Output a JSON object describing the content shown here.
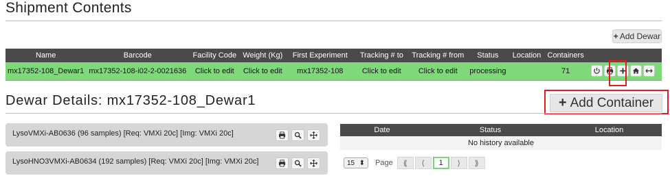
{
  "page_title": "Shipment Contents",
  "add_dewar": {
    "label": "Add Dewar",
    "plus": "+"
  },
  "shipment_table": {
    "headers": [
      "Name",
      "Barcode",
      "Facility Code",
      "Weight (Kg)",
      "First Experiment",
      "Tracking # to",
      "Tracking # from",
      "Status",
      "Location",
      "Containers",
      ""
    ],
    "row": {
      "name": "mx17352-108_Dewar1",
      "barcode": "mx17352-108-i02-2-0021636",
      "facility_code": "Click to edit",
      "weight": "Click to edit",
      "first_experiment": "mx17352-108",
      "tracking_to": "Click to edit",
      "tracking_from": "Click to edit",
      "status": "processing",
      "location": "",
      "containers": "71"
    },
    "row_actions": [
      "power-icon",
      "print-icon",
      "plus-icon",
      "home-icon",
      "transfer-icon"
    ]
  },
  "dewar_details": {
    "title": "Dewar Details: mx17352-108_Dewar1",
    "add_container": {
      "label": "Add Container",
      "plus": "+"
    }
  },
  "containers": [
    {
      "label": "LysoVMXi-AB0636 (96 samples) [Req: VMXi 20c] [Img: VMXi 20c]"
    },
    {
      "label": "LysoHNO3VMXi-AB0634 (192 samples) [Req: VMXi 20c] [Img: VMXi 20c]"
    }
  ],
  "history": {
    "headers": [
      "Date",
      "Status",
      "Location"
    ],
    "empty": "No history available"
  },
  "pager": {
    "per_page": "15",
    "page_label": "Page",
    "first": "⟪",
    "prev": "⟨",
    "current": "1",
    "next": "⟩",
    "last": "⟫"
  },
  "colors": {
    "header_bg": "#4a4a4a",
    "row_bg": "#7fd97a",
    "highlight": "#e01b1b"
  }
}
